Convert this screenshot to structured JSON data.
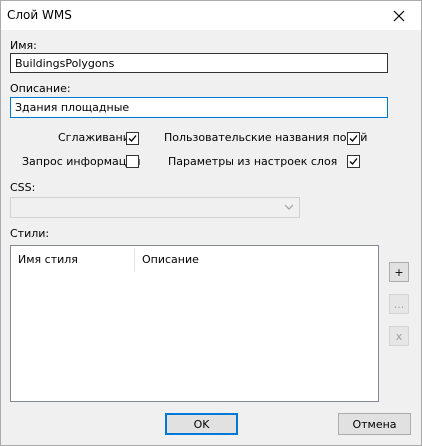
{
  "window": {
    "title": "Слой WMS"
  },
  "name_field": {
    "label": "Имя:",
    "value": "BuildingsPolygons"
  },
  "description_field": {
    "label": "Описание:",
    "value": "Здания площадные"
  },
  "options": {
    "smoothing": {
      "label": "Сглаживание",
      "checked": true
    },
    "custom_field_names": {
      "label": "Пользовательские названия полей",
      "checked": true
    },
    "info_request": {
      "label": "Запрос информации",
      "checked": false
    },
    "layer_settings_params": {
      "label": "Параметры из настроек слоя",
      "checked": true
    }
  },
  "css_field": {
    "label": "CSS:",
    "value": ""
  },
  "styles": {
    "label": "Стили:",
    "columns": [
      "Имя стиля",
      "Описание"
    ],
    "rows": [],
    "add_label": "+",
    "edit_label": "...",
    "remove_label": "x"
  },
  "buttons": {
    "ok": "OK",
    "cancel": "Отмена"
  }
}
